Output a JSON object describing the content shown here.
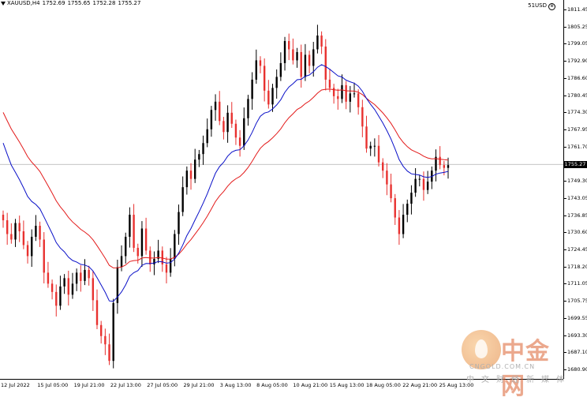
{
  "header": {
    "symbol": "XAUUSD,H4",
    "open": "1752.69",
    "high": "1755.65",
    "low": "1752.28",
    "close": "1755.27",
    "broker": "51USD"
  },
  "price_axis": {
    "labels": [
      "1811.45",
      "1805.25",
      "1799.05",
      "1792.90",
      "1786.60",
      "1780.45",
      "1774.30",
      "1767.95",
      "1761.70",
      "1755.27",
      "1749.30",
      "1743.05",
      "1736.85",
      "1730.60",
      "1724.45",
      "1718.20",
      "1711.05",
      "1705.75",
      "1699.55",
      "1693.30",
      "1687.10",
      "1680.90"
    ],
    "current_price": "1755.27"
  },
  "time_axis": {
    "labels": [
      "12 Jul 2022",
      "15 Jul 05:00",
      "19 Jul 21:00",
      "22 Jul 13:00",
      "27 Jul 05:00",
      "29 Jul 21:00",
      "3 Aug 13:00",
      "8 Aug 05:00",
      "10 Aug 21:00",
      "15 Aug 13:00",
      "18 Aug 05:00",
      "22 Aug 21:00",
      "25 Aug 13:00"
    ]
  },
  "colors": {
    "bull": "#000000",
    "bear": "#e8312f",
    "ma_fast": "#0a10c8",
    "ma_slow": "#e31b1b",
    "current_line": "#b0b0b0"
  },
  "watermark": {
    "title": "中金网",
    "url": "CNGOLD.COM.CN",
    "subtitle": "中文财经新媒体"
  },
  "chart_data": {
    "type": "candlestick",
    "symbol": "XAUUSD",
    "timeframe": "H4",
    "ylim": [
      1680.9,
      1811.45
    ],
    "closes": [
      1735,
      1730,
      1728,
      1734,
      1731,
      1726,
      1722,
      1729,
      1733,
      1728,
      1716,
      1712,
      1709,
      1704,
      1711,
      1714,
      1708,
      1712,
      1716,
      1713,
      1717,
      1714,
      1706,
      1697,
      1693,
      1690,
      1684,
      1705,
      1718,
      1722,
      1729,
      1737,
      1725,
      1722,
      1732,
      1724,
      1719,
      1721,
      1724,
      1719,
      1716,
      1721,
      1730,
      1738,
      1747,
      1753,
      1750,
      1757,
      1759,
      1763,
      1768,
      1775,
      1778,
      1771,
      1767,
      1774,
      1770,
      1765,
      1762,
      1772,
      1779,
      1786,
      1793,
      1791,
      1782,
      1777,
      1783,
      1787,
      1792,
      1800,
      1797,
      1793,
      1796,
      1787,
      1795,
      1791,
      1797,
      1802,
      1798,
      1786,
      1783,
      1780,
      1779,
      1784,
      1778,
      1781,
      1781,
      1776,
      1769,
      1761,
      1762,
      1762,
      1756,
      1753,
      1748,
      1743,
      1736,
      1730,
      1737,
      1741,
      1745,
      1750,
      1750,
      1746,
      1749,
      1753,
      1758,
      1755,
      1754,
      1755
    ]
  }
}
